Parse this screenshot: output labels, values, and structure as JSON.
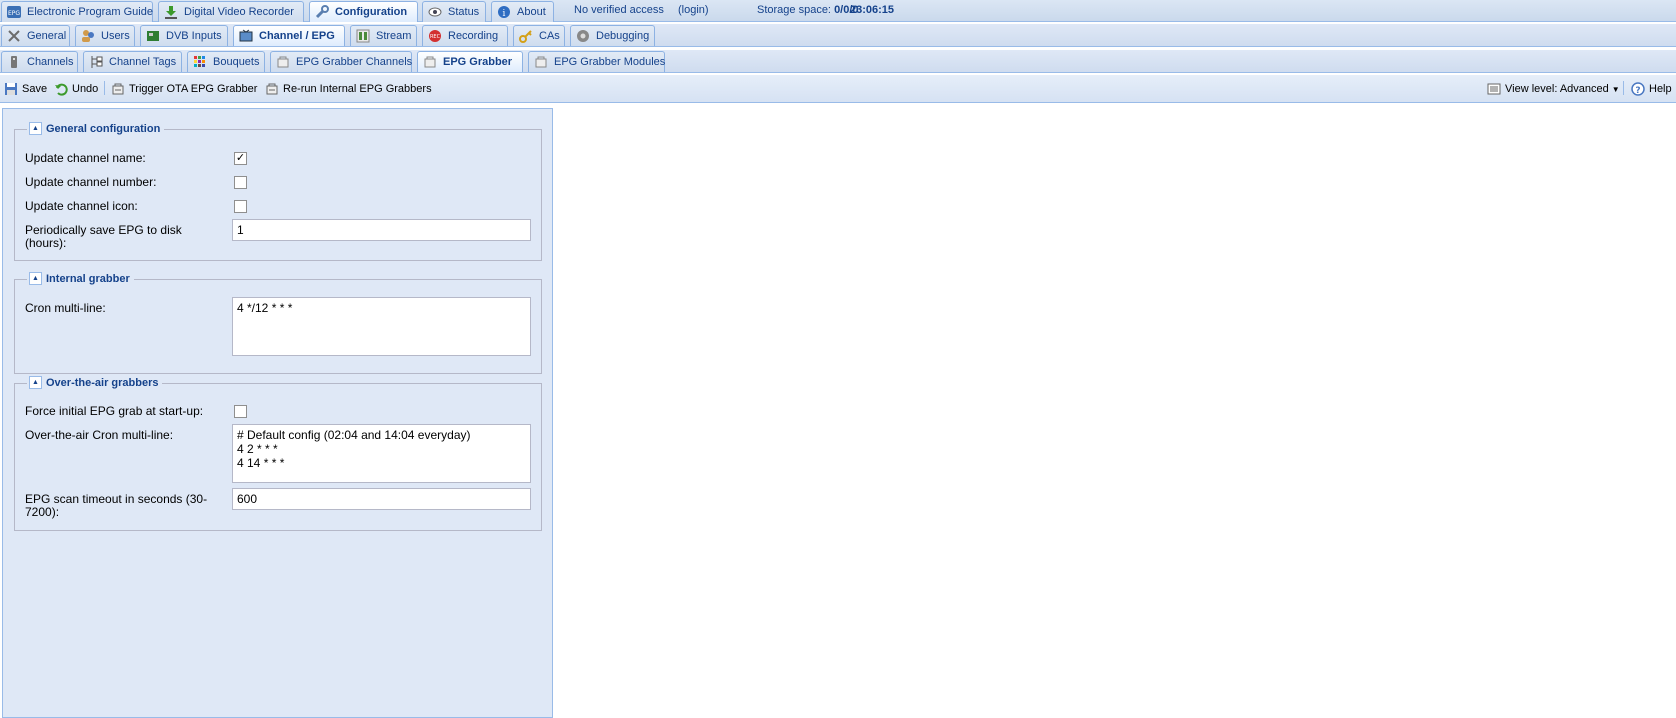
{
  "main_tabs": [
    {
      "label": "Electronic Program Guide",
      "icon": "epg-icon"
    },
    {
      "label": "Digital Video Recorder",
      "icon": "download-icon"
    },
    {
      "label": "Configuration",
      "icon": "wrench-icon"
    },
    {
      "label": "Status",
      "icon": "eye-icon"
    },
    {
      "label": "About",
      "icon": "info-icon"
    }
  ],
  "access": {
    "text": "No verified access",
    "login": "(login)"
  },
  "storage": {
    "label": "Storage space:",
    "value": "0/0/0"
  },
  "clock": "23:06:15",
  "config_tabs": [
    {
      "label": "General",
      "icon": "tools-icon"
    },
    {
      "label": "Users",
      "icon": "users-icon"
    },
    {
      "label": "DVB Inputs",
      "icon": "card-icon"
    },
    {
      "label": "Channel / EPG",
      "icon": "tv-icon"
    },
    {
      "label": "Stream",
      "icon": "stream-icon"
    },
    {
      "label": "Recording",
      "icon": "rec-icon"
    },
    {
      "label": "CAs",
      "icon": "key-icon"
    },
    {
      "label": "Debugging",
      "icon": "bug-icon"
    }
  ],
  "sub_tabs": [
    {
      "label": "Channels",
      "icon": "remote-icon"
    },
    {
      "label": "Channel Tags",
      "icon": "tree-icon"
    },
    {
      "label": "Bouquets",
      "icon": "grid-icon"
    },
    {
      "label": "EPG Grabber Channels",
      "icon": "grabber-icon"
    },
    {
      "label": "EPG Grabber",
      "icon": "grabber-icon"
    },
    {
      "label": "EPG Grabber Modules",
      "icon": "grabber-icon"
    }
  ],
  "toolbar": {
    "save": "Save",
    "undo": "Undo",
    "trigger": "Trigger OTA EPG Grabber",
    "rerun": "Re-run Internal EPG Grabbers",
    "view_level": "View level: Advanced",
    "help": "Help"
  },
  "general": {
    "title": "General configuration",
    "update_name_label": "Update channel name:",
    "update_name_checked": true,
    "update_number_label": "Update channel number:",
    "update_number_checked": false,
    "update_icon_label": "Update channel icon:",
    "update_icon_checked": false,
    "save_epg_label_1": "Periodically save EPG to disk",
    "save_epg_label_2": "(hours):",
    "save_epg_value": "1"
  },
  "internal": {
    "title": "Internal grabber",
    "cron_label": "Cron multi-line:",
    "cron_value": "4 */12 * * *"
  },
  "ota": {
    "title": "Over-the-air grabbers",
    "force_label": "Force initial EPG grab at start-up:",
    "force_checked": false,
    "cron_label": "Over-the-air Cron multi-line:",
    "cron_value": "# Default config (02:04 and 14:04 everyday)\n4 2 * * *\n4 14 * * *",
    "timeout_label_1": "EPG scan timeout in seconds (30-",
    "timeout_label_2": "7200):",
    "timeout_value": "600"
  }
}
